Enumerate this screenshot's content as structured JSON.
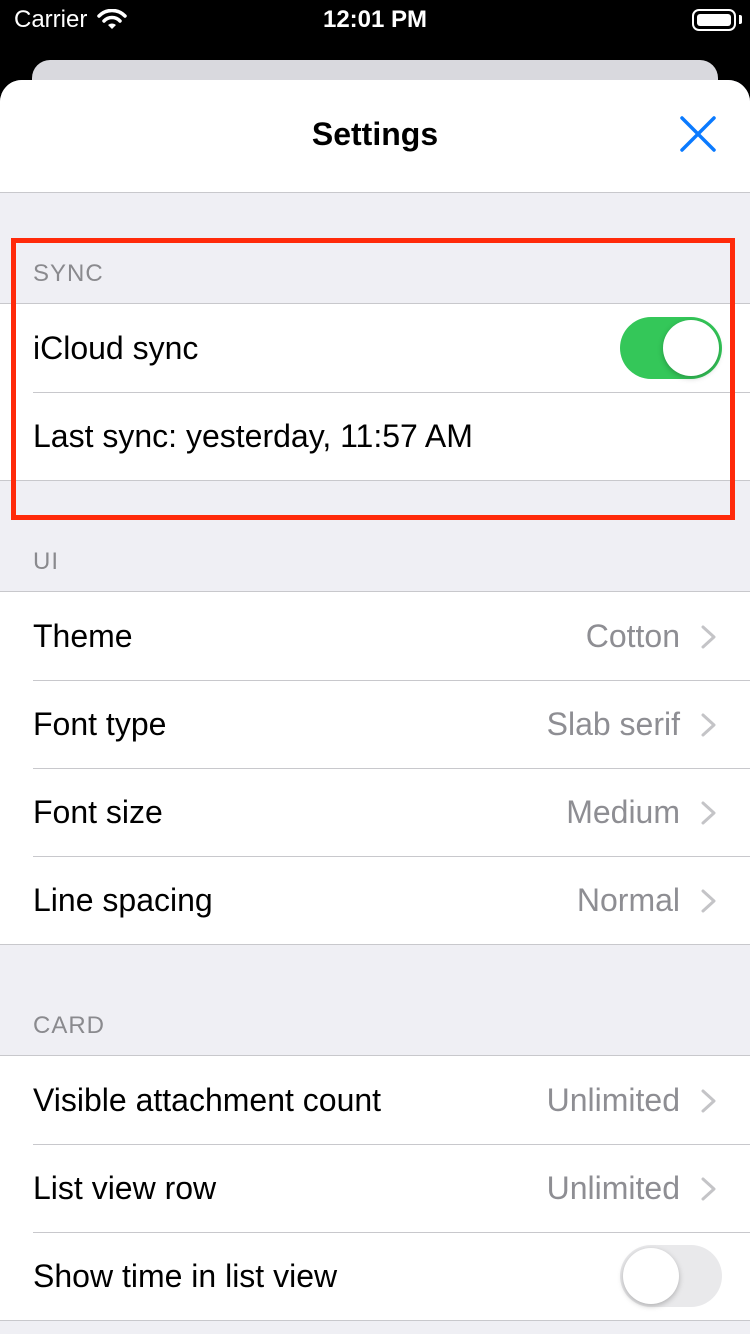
{
  "status_bar": {
    "carrier": "Carrier",
    "time": "12:01 PM"
  },
  "nav": {
    "title": "Settings",
    "close_icon": "close-icon"
  },
  "sections": {
    "sync": {
      "header": "SYNC",
      "icloud_label": "iCloud sync",
      "icloud_on": true,
      "last_sync": "Last sync: yesterday, 11:57 AM"
    },
    "ui": {
      "header": "UI",
      "rows": [
        {
          "label": "Theme",
          "value": "Cotton"
        },
        {
          "label": "Font type",
          "value": "Slab serif"
        },
        {
          "label": "Font size",
          "value": "Medium"
        },
        {
          "label": "Line spacing",
          "value": "Normal"
        }
      ]
    },
    "card": {
      "header": "CARD",
      "rows": [
        {
          "label": "Visible attachment count",
          "value": "Unlimited"
        },
        {
          "label": "List view row",
          "value": "Unlimited"
        }
      ],
      "show_time_label": "Show time in list view",
      "show_time_on": false
    }
  },
  "colors": {
    "accent": "#0a7aff",
    "toggle_on": "#34c759",
    "highlight": "#ff2a0a"
  }
}
